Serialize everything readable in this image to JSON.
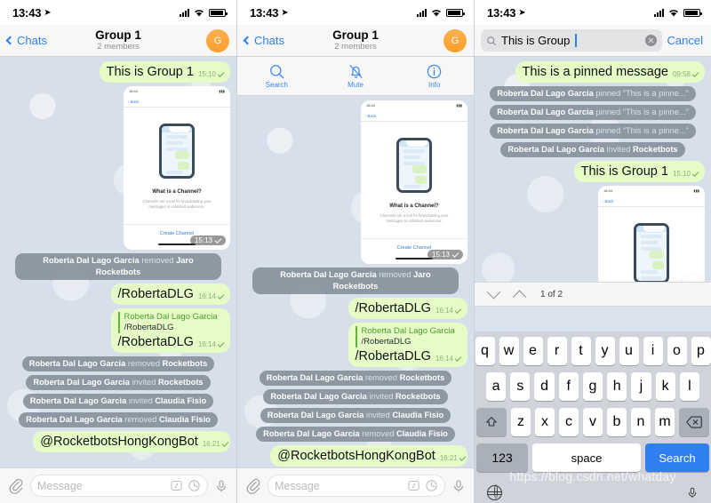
{
  "status_bar": {
    "time": "13:43",
    "location_arrow": "location-arrow-icon"
  },
  "panels": [
    {
      "id": "panel-chat",
      "nav": {
        "back_label": "Chats",
        "title": "Group 1",
        "subtitle": "2 members",
        "avatar_initial": "G"
      },
      "has_action_toolbar": false,
      "input": {
        "placeholder": "Message"
      }
    },
    {
      "id": "panel-chat-actions",
      "nav": {
        "back_label": "Chats",
        "title": "Group 1",
        "subtitle": "2 members",
        "avatar_initial": "G"
      },
      "has_action_toolbar": true,
      "actions": [
        {
          "label": "Search",
          "icon": "search-icon"
        },
        {
          "label": "Mute",
          "icon": "bell-slash-icon"
        },
        {
          "label": "Info",
          "icon": "info-circle-icon"
        }
      ],
      "input": {
        "placeholder": "Message"
      }
    },
    {
      "id": "panel-search",
      "search": {
        "icon": "search-icon",
        "value": "This is Group",
        "clear_icon": "clear-circle-icon",
        "cancel_label": "Cancel"
      },
      "search_nav": {
        "down_icon": "chevron-down-icon",
        "up_icon": "chevron-up-icon",
        "count_label": "1 of 2"
      }
    }
  ],
  "messages": {
    "first_bubble": {
      "text": "This is Group 1",
      "time": "15:10"
    },
    "photo": {
      "time": "15:13"
    },
    "service_removed_jaro": {
      "name": "Roberta Dal Lago Garcia",
      "action": "removed",
      "target": "Jaro Rocketbots"
    },
    "cmd1": {
      "text": "/RobertaDLG",
      "time": "16:14"
    },
    "reply": {
      "quote_name": "Roberta Dal Lago Garcia",
      "quote_text": "/RobertaDLG",
      "text": "/RobertaDLG",
      "time": "16:14"
    },
    "service_removed_rb": {
      "name": "Roberta Dal Lago Garcia",
      "action": "removed",
      "target": "Rocketbots"
    },
    "service_invited_rb": {
      "name": "Roberta Dal Lago Garcia",
      "action": "invited",
      "target": "Rocketbots"
    },
    "service_invited_cf": {
      "name": "Roberta Dal Lago Garcia",
      "action": "invited",
      "target": "Claudia Fisio"
    },
    "service_removed_cf": {
      "name": "Roberta Dal Lago Garcia",
      "action": "removed",
      "target": "Claudia Fisio"
    },
    "bot_mention": {
      "text": "@RocketbotsHongKongBot",
      "time": "16:21"
    },
    "pinned_msg": {
      "text": "This is a pinned message",
      "time": "09:58"
    },
    "service_pinned": {
      "name": "Roberta Dal Lago Garcia",
      "action": "pinned",
      "target": "“This is a pinne...”"
    }
  },
  "photo_content": {
    "back_label": "Back",
    "title": "What is a Channel?",
    "description": "Channels are a tool for broadcasting your messages to unlimited audiences.",
    "cta": "Create Channel",
    "mini_status_time": "18:44"
  },
  "input_icons": {
    "attach": "paperclip-icon",
    "command": "slash-command-icon",
    "sticker": "sticker-icon",
    "mic": "microphone-icon"
  },
  "keyboard": {
    "row1": [
      "q",
      "w",
      "e",
      "r",
      "t",
      "y",
      "u",
      "i",
      "o",
      "p"
    ],
    "row2": [
      "a",
      "s",
      "d",
      "f",
      "g",
      "h",
      "j",
      "k",
      "l"
    ],
    "row3": [
      "z",
      "x",
      "c",
      "v",
      "b",
      "n",
      "m"
    ],
    "shift_icon": "shift-icon",
    "backspace_icon": "backspace-icon",
    "numeric_label": "123",
    "space_label": "space",
    "search_label": "Search",
    "globe_icon": "globe-icon",
    "dictation_icon": "microphone-icon"
  },
  "watermark": "https://blog.csdn.net/whatday",
  "colors": {
    "accent_blue": "#2f7ff0",
    "out_bubble_green": "#e5fcc7",
    "service_gray": "#7d8894",
    "wallpaper": "#d7e0ea",
    "avatar_orange": "#ff9d2e"
  }
}
